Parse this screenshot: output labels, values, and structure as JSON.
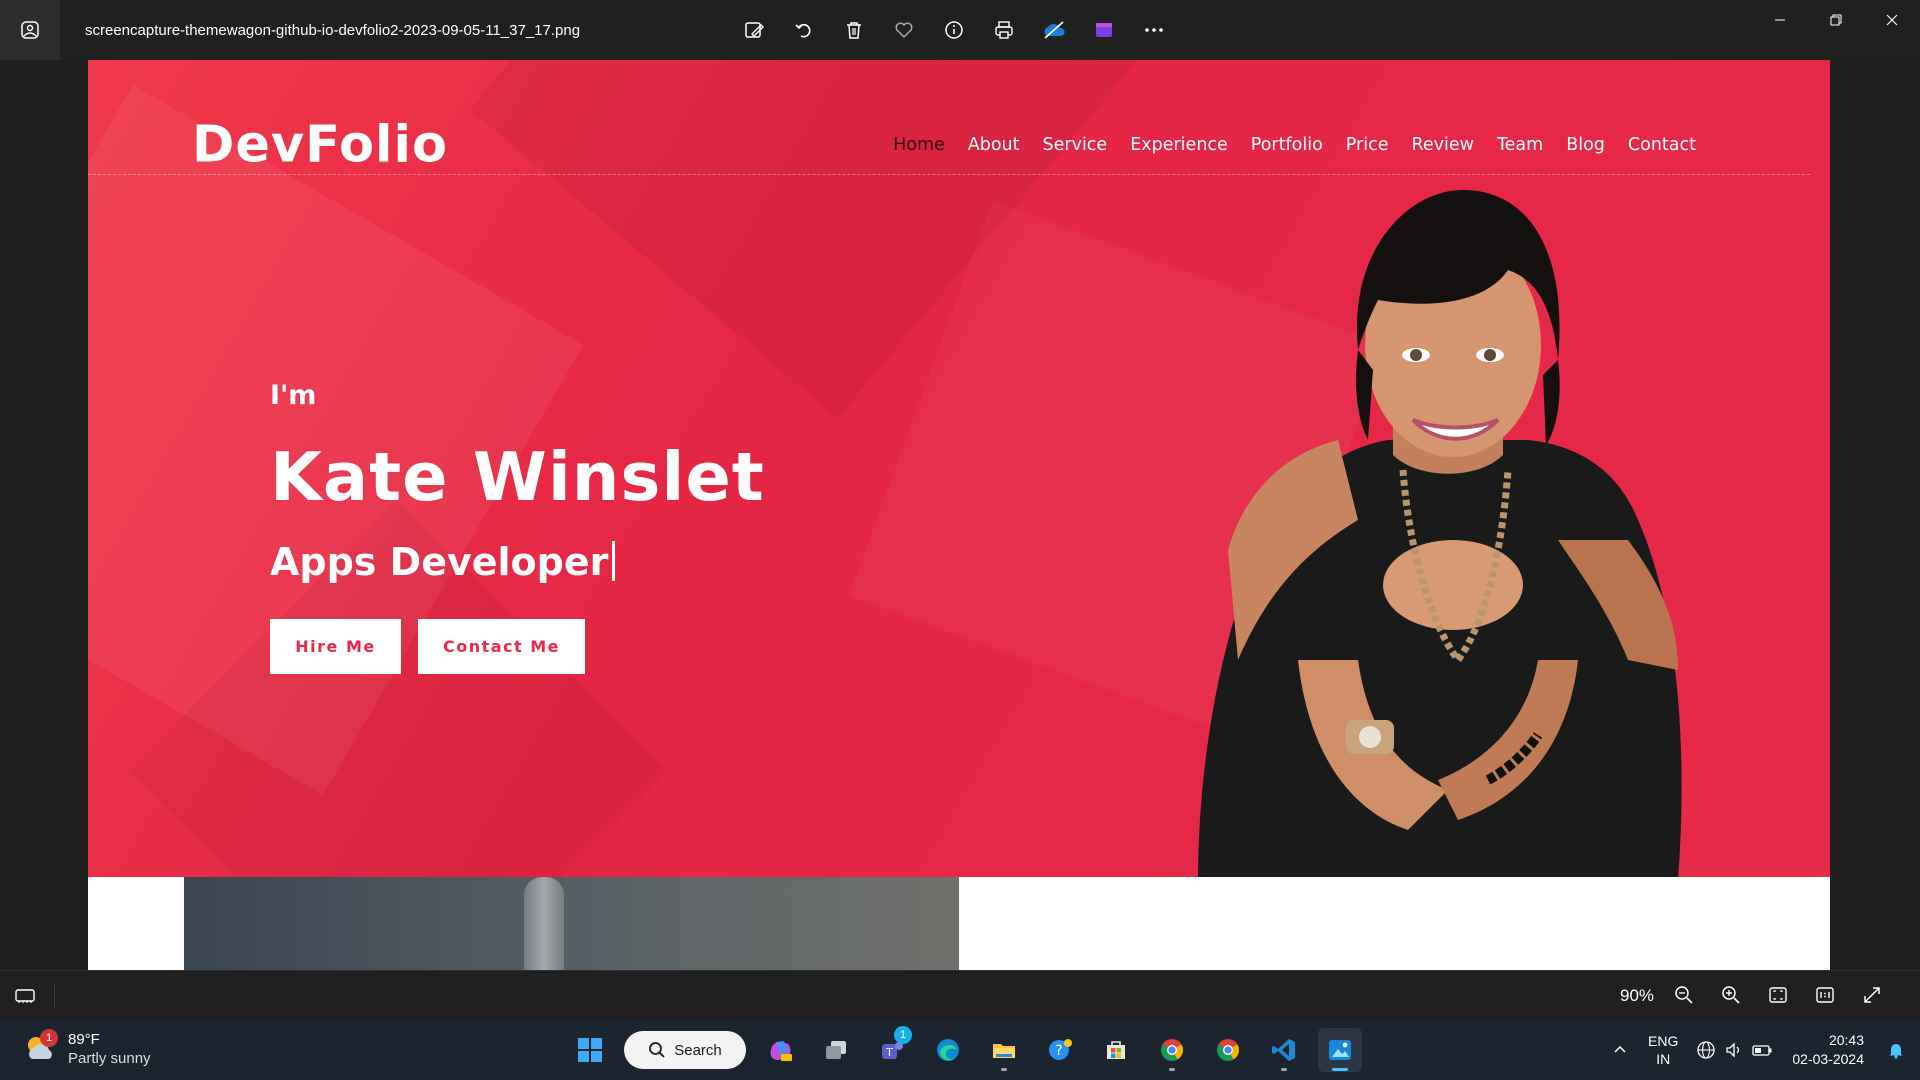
{
  "viewer": {
    "file_name": "screencapture-themewagon-github-io-devfolio2-2023-09-05-11_37_17.png",
    "tools": [
      "edit-image-icon",
      "rotate-icon",
      "delete-icon",
      "favorite-icon",
      "info-icon",
      "print-icon",
      "onedrive-icon",
      "clipchamp-icon",
      "more-icon"
    ],
    "zoom": "90%"
  },
  "site": {
    "logo": "DevFolio",
    "nav": [
      "Home",
      "About",
      "Service",
      "Experience",
      "Portfolio",
      "Price",
      "Review",
      "Team",
      "Blog",
      "Contact"
    ],
    "active_nav": "Home",
    "intro": "I'm",
    "name": "Kate Winslet",
    "role": "Apps Developer",
    "buttons": {
      "hire": "Hire Me",
      "contact": "Contact Me"
    },
    "accent_color": "#e8294a"
  },
  "taskbar": {
    "weather": {
      "temp": "89°F",
      "condition": "Partly sunny",
      "badge": "1"
    },
    "search_label": "Search",
    "teams_badge": "1",
    "tray": {
      "lang_line1": "ENG",
      "lang_line2": "IN",
      "time": "20:43",
      "date": "02-03-2024"
    }
  }
}
